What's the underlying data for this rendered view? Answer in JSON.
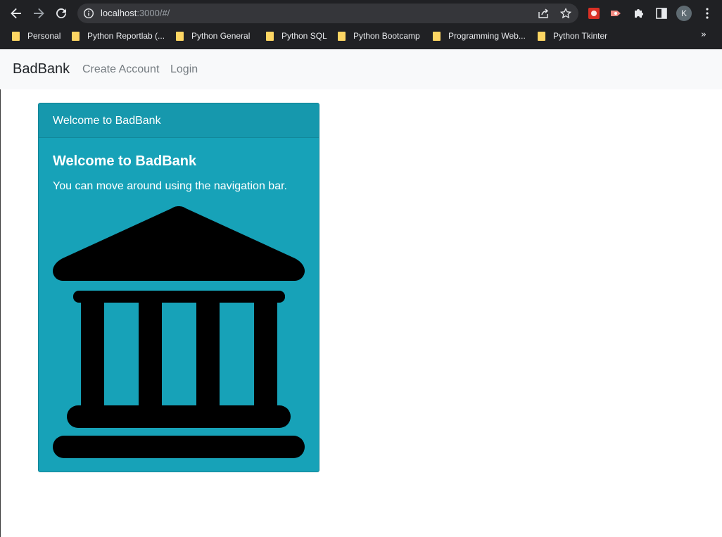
{
  "browser": {
    "url_host": "localhost",
    "url_path": ":3000/#/",
    "avatar_initial": "K",
    "bookmarks": [
      {
        "label": "Personal"
      },
      {
        "label": "Python Reportlab (..."
      },
      {
        "label": "Python General"
      },
      {
        "label": "Python SQL"
      },
      {
        "label": "Python Bootcamp"
      },
      {
        "label": "Programming Web..."
      },
      {
        "label": "Python Tkinter"
      }
    ],
    "bookmarks_more": "»"
  },
  "navbar": {
    "brand": "BadBank",
    "links": [
      {
        "label": "Create Account"
      },
      {
        "label": "Login"
      }
    ]
  },
  "card": {
    "header": "Welcome to BadBank",
    "title": "Welcome to BadBank",
    "text": "You can move around using the navigation bar.",
    "image_icon": "bank-building-icon",
    "background_color": "#17a2b8"
  }
}
